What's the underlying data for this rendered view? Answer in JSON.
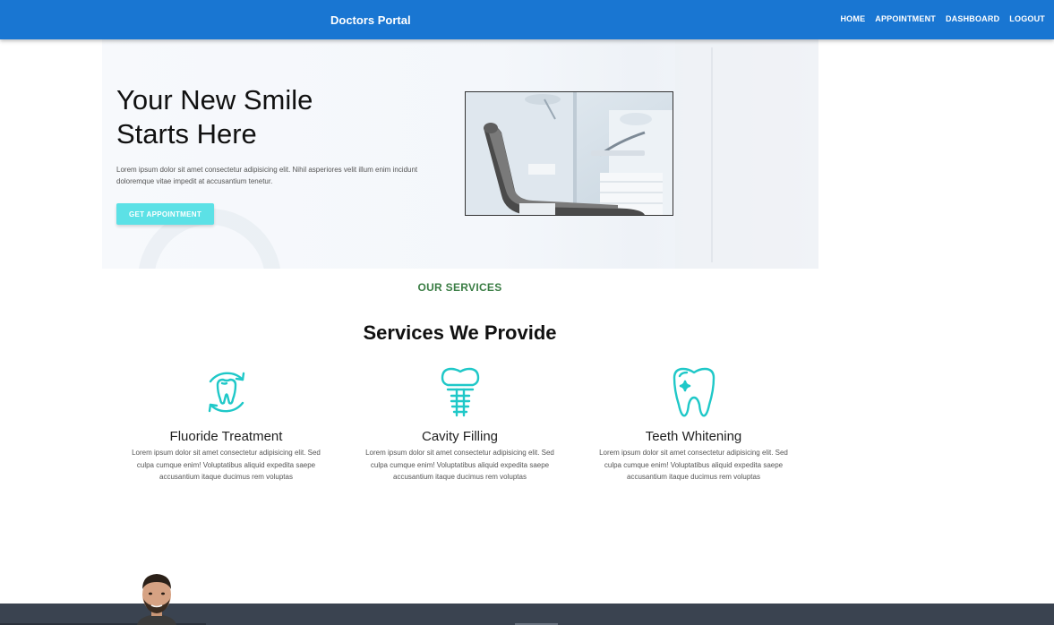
{
  "navbar": {
    "brand": "Doctors Portal",
    "links": [
      "HOME",
      "APPOINTMENT",
      "DASHBOARD",
      "LOGOUT"
    ]
  },
  "hero": {
    "title_line1": "Your New Smile",
    "title_line2": "Starts Here",
    "text": "Lorem ipsum dolor sit amet consectetur adipisicing elit. Nihil asperiores velit illum enim incidunt doloremque vitae impedit at accusantium tenetur.",
    "cta_label": "GET APPOINTMENT",
    "image_icon": "dental-chair-image"
  },
  "services": {
    "eyebrow": "OUR SERVICES",
    "title": "Services We Provide",
    "items": [
      {
        "name": "Fluoride Treatment",
        "icon": "tooth-cycle-icon",
        "description": "Lorem ipsum dolor sit amet consectetur adipisicing elit. Sed culpa cumque enim! Voluptatibus aliquid expedita saepe accusantium itaque ducimus rem voluptas"
      },
      {
        "name": "Cavity Filling",
        "icon": "dental-implant-icon",
        "description": "Lorem ipsum dolor sit amet consectetur adipisicing elit. Sed culpa cumque enim! Voluptatibus aliquid expedita saepe accusantium itaque ducimus rem voluptas"
      },
      {
        "name": "Teeth Whitening",
        "icon": "sparkling-tooth-icon",
        "description": "Lorem ipsum dolor sit amet consectetur adipisicing elit. Sed culpa cumque enim! Voluptatibus aliquid expedita saepe accusantium itaque ducimus rem voluptas"
      }
    ]
  },
  "colors": {
    "navbar": "#1976d2",
    "accent": "#5ce1e6",
    "icon": "#1fc8c8",
    "eyebrow": "#3a7d44",
    "footer_band": "#3a4350"
  }
}
